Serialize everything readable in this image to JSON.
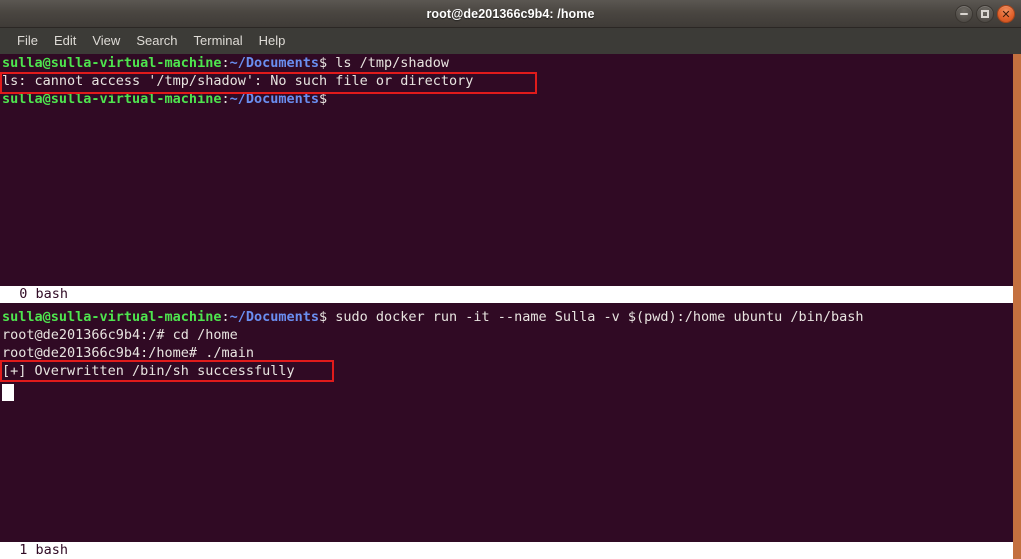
{
  "window": {
    "title": "root@de201366c9b4: /home",
    "controls": {
      "minimize_label": "–",
      "maximize_label": "□",
      "close_label": "✕"
    }
  },
  "menubar": {
    "items": [
      {
        "label": "File"
      },
      {
        "label": "Edit"
      },
      {
        "label": "View"
      },
      {
        "label": "Search"
      },
      {
        "label": "Terminal"
      },
      {
        "label": "Help"
      }
    ]
  },
  "theme": {
    "terminal_background": "#300a24",
    "prompt_user_color": "#4ee44e",
    "prompt_path_color": "#6a8ef0",
    "text_color": "#e8e4e0",
    "statusbar_background": "#ffffff",
    "statusbar_text_color": "#300a24",
    "annotation_color": "#e01b1b",
    "window_border_color": "#c4703f"
  },
  "panes": [
    {
      "id": "pane-top",
      "status": "  0 bash",
      "lines": [
        {
          "segments": [
            {
              "text": "sulla@sulla-virtual-machine",
              "style": "green"
            },
            {
              "text": ":",
              "style": "white"
            },
            {
              "text": "~/Documents",
              "style": "blue"
            },
            {
              "text": "$ ls /tmp/shadow",
              "style": "white"
            }
          ]
        },
        {
          "segments": [
            {
              "text": "ls: cannot access '/tmp/shadow': No such file or directory",
              "style": "white"
            }
          ]
        },
        {
          "segments": [
            {
              "text": "sulla@sulla-virtual-machine",
              "style": "green"
            },
            {
              "text": ":",
              "style": "white"
            },
            {
              "text": "~/Documents",
              "style": "blue"
            },
            {
              "text": "$",
              "style": "white"
            }
          ]
        }
      ]
    },
    {
      "id": "pane-bottom",
      "status": "  1 bash",
      "lines": [
        {
          "segments": [
            {
              "text": "sulla@sulla-virtual-machine",
              "style": "green"
            },
            {
              "text": ":",
              "style": "white"
            },
            {
              "text": "~/Documents",
              "style": "blue"
            },
            {
              "text": "$ sudo docker run -it --name Sulla -v $(pwd):/home ubuntu /bin/bash",
              "style": "white"
            }
          ]
        },
        {
          "segments": [
            {
              "text": "root@de201366c9b4:/# cd /home",
              "style": "white"
            }
          ]
        },
        {
          "segments": [
            {
              "text": "root@de201366c9b4:/home# ./main",
              "style": "white"
            }
          ]
        },
        {
          "segments": [
            {
              "text": "[+] Overwritten /bin/sh successfully",
              "style": "white"
            }
          ]
        }
      ]
    }
  ],
  "annotations": [
    {
      "name": "highlight-ls-error",
      "text": "ls: cannot access '/tmp/shadow': No such file or directory"
    },
    {
      "name": "highlight-overwrite-success",
      "text": "[+] Overwritten /bin/sh successfully"
    }
  ]
}
